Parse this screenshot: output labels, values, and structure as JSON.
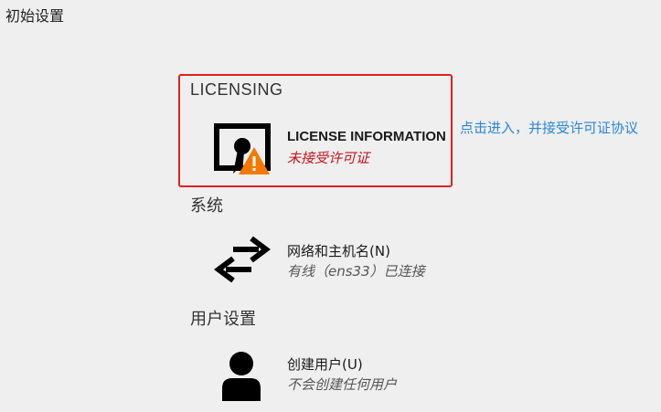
{
  "page_title": "初始设置",
  "annotation": "点击进入，并接受许可证协议",
  "sections": {
    "licensing": {
      "title": "LICENSING",
      "spoke": {
        "title": "LICENSE INFORMATION",
        "status": "未接受许可证",
        "icon": "license-document-warning-icon"
      }
    },
    "system": {
      "title": "系统",
      "spoke": {
        "title": "网络和主机名(N)",
        "status": "有线（ens33）已连接",
        "icon": "network-arrows-icon"
      }
    },
    "user_settings": {
      "title": "用户设置",
      "spoke": {
        "title": "创建用户(U)",
        "status": "不会创建任何用户",
        "icon": "user-icon"
      }
    }
  },
  "colors": {
    "highlight_border": "#e0201f",
    "annotation_text": "#2a87d8",
    "warning_status": "#c8131b",
    "warning_triangle": "#f57900"
  }
}
